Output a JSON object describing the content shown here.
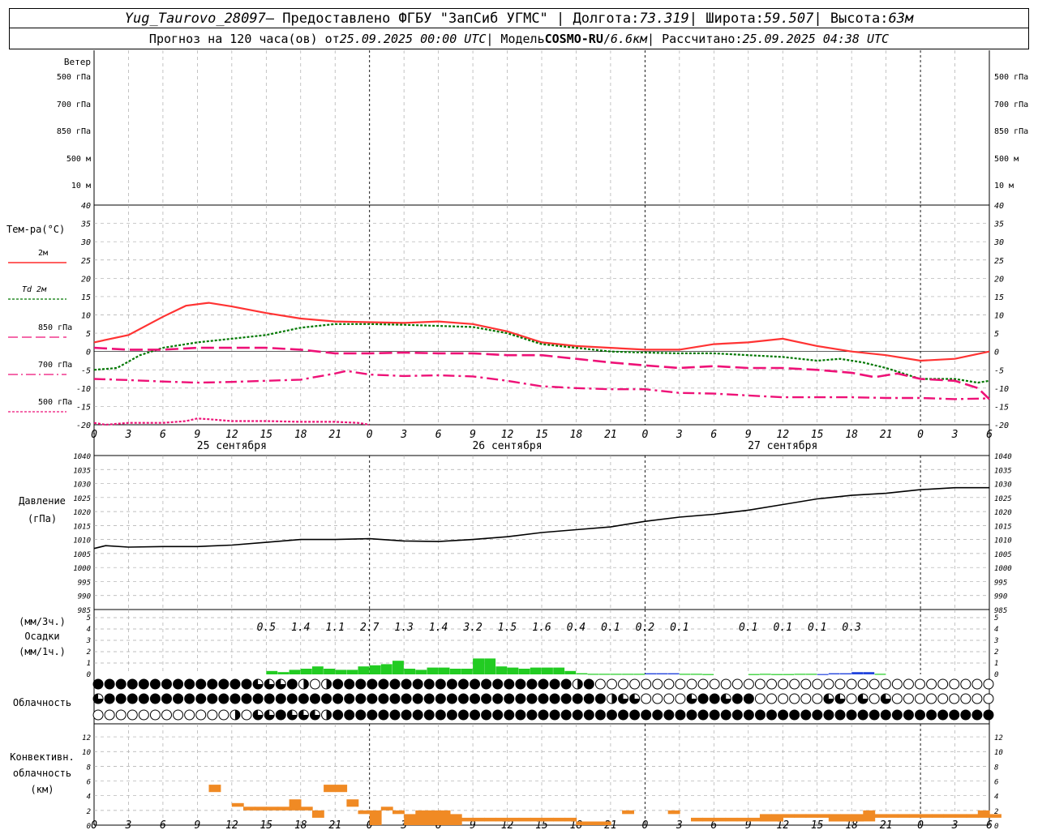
{
  "header": {
    "station": "Yug_Taurovo_28097",
    "provided": " – Предоставлено ФГБУ \"ЗапСиб УГМС\" | Долгота: ",
    "lon": "73.319",
    "lat_label": " | Широта: ",
    "lat": "59.507",
    "alt_label": " | Высота: ",
    "alt": "63м",
    "forecast_prefix": "Прогноз на 120 часа(ов) от ",
    "forecast_start": "25.09.2025 00:00 UTC",
    "model_label": "  | Модель ",
    "model": "COSMO-RU",
    "model_sep": " / ",
    "resolution": "6.6км",
    "calc_label": " | Рассчитано: ",
    "calc_time": "25.09.2025 04:38 UTC"
  },
  "wind_panel": {
    "title": "Ветер",
    "levels": [
      "500 гПа",
      "700 гПа",
      "850 гПа",
      "500 м",
      "10  м"
    ]
  },
  "temp_panel": {
    "title": "Тем-ра(°С)",
    "legend": [
      "2м",
      "Td  2м",
      "850 гПа",
      "700 гПа",
      "500 гПа"
    ],
    "legend_colors": [
      "#ff0000",
      "#007700",
      "#ee1177",
      "#ee1177",
      "#ee1177"
    ],
    "yticks": [
      "40",
      "35",
      "30",
      "25",
      "20",
      "15",
      "10",
      "5",
      "0",
      "-5",
      "-10",
      "-15",
      "-20"
    ]
  },
  "pressure_panel": {
    "title": "Давление",
    "unit": "(гПа)",
    "yticks": [
      "1040",
      "1035",
      "1030",
      "1025",
      "1020",
      "1015",
      "1010",
      "1005",
      "1000",
      "995",
      "990",
      "985"
    ]
  },
  "precip_panel": {
    "unit_3h": "(мм/3ч.)",
    "title": "Осадки",
    "unit_1h": "(мм/1ч.)",
    "yticks": [
      "5",
      "4",
      "3",
      "2",
      "1",
      "0"
    ],
    "totals": [
      {
        "hour": 15,
        "value": "0.5"
      },
      {
        "hour": 18,
        "value": "1.4"
      },
      {
        "hour": 21,
        "value": "1.1"
      },
      {
        "hour": 24,
        "value": "2.7"
      },
      {
        "hour": 27,
        "value": "1.3"
      },
      {
        "hour": 30,
        "value": "1.4"
      },
      {
        "hour": 33,
        "value": "3.2"
      },
      {
        "hour": 36,
        "value": "1.5"
      },
      {
        "hour": 39,
        "value": "1.6"
      },
      {
        "hour": 42,
        "value": "0.4"
      },
      {
        "hour": 45,
        "value": "0.1"
      },
      {
        "hour": 48,
        "value": "0.2"
      },
      {
        "hour": 51,
        "value": "0.1"
      },
      {
        "hour": 57,
        "value": "0.1"
      },
      {
        "hour": 60,
        "value": "0.1"
      },
      {
        "hour": 63,
        "value": "0.1"
      },
      {
        "hour": 66,
        "value": "0.3"
      }
    ]
  },
  "cloud_panel": {
    "title": "Облачность"
  },
  "conv_panel": {
    "title1": "Конвективн.",
    "title2": "облачность",
    "unit": "(км)",
    "yticks": [
      "12",
      "10",
      "8",
      "6",
      "4",
      "2",
      "0"
    ]
  },
  "x_axis": {
    "tick_labels": [
      "0",
      "3",
      "6",
      "9",
      "12",
      "15",
      "18",
      "21",
      "0",
      "3",
      "6",
      "9",
      "12",
      "15",
      "18",
      "21",
      "0",
      "3",
      "6",
      "9",
      "12",
      "15",
      "18",
      "21",
      "0",
      "3",
      "6"
    ],
    "day_labels": [
      "25 сентября",
      "26 сентября",
      "27 сентября"
    ]
  },
  "chart_data": {
    "type": "meteogram",
    "x_unit": "hours since 25.09.2025 00:00 UTC",
    "x_range": [
      0,
      78
    ],
    "temperature": {
      "ylim": [
        -20,
        40
      ],
      "series": [
        {
          "name": "2м",
          "color": "#ff3333",
          "style": "solid",
          "x": [
            0,
            3,
            6,
            8,
            10,
            12,
            15,
            18,
            21,
            24,
            27,
            30,
            33,
            36,
            39,
            42,
            45,
            48,
            51,
            54,
            57,
            60,
            63,
            66,
            69,
            72,
            75,
            78
          ],
          "y": [
            2.5,
            4.5,
            9.5,
            12.5,
            13.3,
            12.3,
            10.5,
            9,
            8.2,
            8,
            7.8,
            8.2,
            7.5,
            5.5,
            2.5,
            1.5,
            1,
            0.5,
            0.5,
            2,
            2.5,
            3.5,
            1.5,
            0,
            -1,
            -2.5,
            -2,
            0
          ]
        },
        {
          "name": "Td  2м",
          "color": "#007700",
          "style": "dotted",
          "x": [
            0,
            2,
            4,
            6,
            9,
            12,
            15,
            18,
            21,
            24,
            27,
            30,
            33,
            36,
            39,
            42,
            45,
            48,
            51,
            54,
            57,
            60,
            63,
            65,
            67,
            69,
            72,
            75,
            77,
            78
          ],
          "y": [
            -5,
            -4.5,
            -1,
            1,
            2.5,
            3.5,
            4.5,
            6.5,
            7.5,
            7.5,
            7.3,
            7,
            6.7,
            5,
            2,
            1,
            0,
            -0.3,
            -0.5,
            -0.5,
            -1,
            -1.5,
            -2.5,
            -2,
            -3,
            -4.5,
            -7.5,
            -7.5,
            -8.5,
            -8
          ]
        },
        {
          "name": "850 гПа",
          "color": "#ee1177",
          "style": "dash",
          "x": [
            0,
            3,
            6,
            9,
            12,
            15,
            18,
            21,
            24,
            27,
            30,
            33,
            36,
            39,
            42,
            45,
            48,
            51,
            54,
            57,
            60,
            63,
            66,
            68,
            69,
            70,
            72,
            75,
            77,
            78
          ],
          "y": [
            1,
            0.5,
            0.5,
            1,
            1,
            1,
            0.5,
            -0.5,
            -0.5,
            -0.3,
            -0.5,
            -0.5,
            -1,
            -1,
            -2,
            -3,
            -3.8,
            -4.5,
            -4,
            -4.5,
            -4.5,
            -5,
            -5.8,
            -7,
            -6.5,
            -6,
            -7.5,
            -8,
            -10,
            -13
          ]
        },
        {
          "name": "700 гПа",
          "color": "#ee1177",
          "style": "dashdot",
          "x": [
            0,
            3,
            6,
            9,
            12,
            15,
            18,
            21,
            22,
            24,
            27,
            30,
            33,
            36,
            39,
            42,
            45,
            48,
            51,
            54,
            57,
            60,
            63,
            66,
            69,
            72,
            75,
            78
          ],
          "y": [
            -7.5,
            -7.8,
            -8.2,
            -8.5,
            -8.3,
            -8,
            -7.7,
            -6,
            -5.3,
            -6.3,
            -6.7,
            -6.5,
            -6.8,
            -8,
            -9.5,
            -10,
            -10.3,
            -10.3,
            -11.3,
            -11.5,
            -12,
            -12.5,
            -12.5,
            -12.5,
            -12.7,
            -12.7,
            -13,
            -12.8
          ]
        },
        {
          "name": "500 гПа",
          "color": "#ee1177",
          "style": "dotted",
          "x": [
            0,
            1,
            3,
            6,
            8,
            9,
            10,
            12,
            15,
            18,
            21,
            23,
            24
          ],
          "y": [
            -19.5,
            -20,
            -19.5,
            -19.5,
            -19,
            -18.3,
            -18.5,
            -19,
            -19,
            -19.2,
            -19.2,
            -19.5,
            -20
          ]
        }
      ]
    },
    "pressure": {
      "ylim": [
        985,
        1040
      ],
      "x": [
        0,
        1,
        3,
        6,
        9,
        12,
        15,
        18,
        21,
        24,
        27,
        30,
        33,
        36,
        39,
        42,
        45,
        48,
        51,
        54,
        57,
        60,
        63,
        66,
        69,
        72,
        75,
        78
      ],
      "y": [
        1006.8,
        1007.8,
        1007.3,
        1007.5,
        1007.5,
        1008,
        1009,
        1010,
        1010,
        1010.3,
        1009.5,
        1009.3,
        1010,
        1011,
        1012.5,
        1013.5,
        1014.5,
        1016.5,
        1018,
        1019,
        1020.5,
        1022.5,
        1024.5,
        1025.8,
        1026.5,
        1027.8,
        1028.5,
        1028.5
      ]
    },
    "precip_hourly": {
      "ylim": [
        0,
        5
      ],
      "x": [
        15,
        16,
        17,
        18,
        19,
        20,
        21,
        22,
        23,
        24,
        25,
        26,
        27,
        28,
        29,
        30,
        31,
        32,
        33,
        34,
        35,
        36,
        37,
        38,
        39,
        40,
        41,
        42,
        43,
        44,
        45,
        46,
        47,
        48,
        49,
        50,
        51,
        52,
        53,
        54,
        55,
        56,
        57,
        58,
        59,
        60,
        61,
        62,
        63,
        64,
        65,
        66,
        67,
        68
      ],
      "y": [
        0.3,
        0.2,
        0.4,
        0.5,
        0.7,
        0.5,
        0.4,
        0.4,
        0.7,
        0.8,
        0.9,
        1.2,
        0.5,
        0.4,
        0.6,
        0.6,
        0.5,
        0.5,
        1.4,
        1.4,
        0.7,
        0.6,
        0.5,
        0.6,
        0.6,
        0.6,
        0.3,
        0.1,
        0.05,
        0.05,
        0.05,
        0.05,
        0.05,
        0.1,
        0.1,
        0.1,
        0.05,
        0.05,
        0.03,
        0,
        0,
        0,
        0.03,
        0.05,
        0.03,
        0.03,
        0.05,
        0.05,
        0.03,
        0.1,
        0.1,
        0.2,
        0.2,
        0.05
      ],
      "colors_note": "green = rain, blue = snow",
      "snow_x": [
        48,
        49,
        50,
        63,
        64,
        65,
        66,
        67
      ]
    },
    "cloudiness": {
      "rows": [
        "high",
        "middle",
        "low"
      ],
      "step_hours": 1,
      "high": "FFFFFFFFFFFFFFQQQFHEHFFFFFFFFFFFFFFFFFFFFFHFEEEEEEEEEEEEEEEEEEEEEEEEEEEEEEEEEEEEEEEE",
      "middle": "QFFFFFFFFFFFFFFFFFFFFFFFFFFFFFFFFFFFFFFFFFFFFHQQEEEEQFFQFFEEEEEEQQEQEQEEEEEEEEEEEEEEE",
      "low": "EEEEEEEEEEEEHEQQFQQQHFFFFFFFFFFFFFFFFFFFFFFFFFFFFFFFFFFFFFFFFFFFFFFFFFFFFFFFFFFFFFFF"
    },
    "convective_cloud": {
      "ylim": [
        0,
        13
      ],
      "unit": "km",
      "x": [
        10,
        11,
        12,
        13,
        14,
        15,
        16,
        17,
        18,
        19,
        20,
        21,
        22,
        23,
        24,
        25,
        26,
        27,
        28,
        29,
        30,
        31,
        32,
        33,
        34,
        35,
        36,
        37,
        38,
        39,
        40,
        41,
        42,
        43,
        44,
        45,
        46,
        47,
        48,
        49,
        50,
        51,
        52,
        53,
        54,
        55,
        56,
        57,
        58,
        59,
        60,
        61,
        62,
        63,
        64,
        65,
        66,
        67,
        68,
        69,
        70,
        71,
        72,
        73,
        74,
        75,
        76,
        77,
        78
      ],
      "bottom": [
        4.5,
        null,
        2.5,
        2,
        2,
        2,
        2,
        2,
        2,
        1,
        4.5,
        4.5,
        2.5,
        1.5,
        0,
        2,
        1.5,
        0,
        0,
        0,
        0,
        0,
        0.5,
        0.5,
        0.5,
        0.5,
        0.5,
        0.5,
        0.5,
        0.5,
        0.5,
        0.5,
        0,
        0,
        0,
        null,
        1.5,
        null,
        null,
        null,
        1.5,
        null,
        0.5,
        0.5,
        0.5,
        0.5,
        0.5,
        0.5,
        0.5,
        0.5,
        1,
        1,
        1,
        1,
        0.5,
        0.5,
        0.5,
        0.5,
        1,
        1,
        1,
        1,
        1,
        1,
        1,
        1,
        1,
        1,
        1
      ],
      "top": [
        5.5,
        null,
        3,
        2.5,
        2.5,
        2.5,
        2.5,
        3.5,
        2.5,
        2,
        5.5,
        5.5,
        3.5,
        2,
        2,
        2.5,
        2,
        1.5,
        2,
        2,
        2,
        1.5,
        1,
        1,
        1,
        1,
        1,
        1,
        1,
        1,
        1,
        1,
        0.5,
        0.5,
        0.5,
        null,
        2,
        null,
        null,
        null,
        2,
        null,
        1,
        1,
        1,
        1,
        1,
        1,
        1.5,
        1.5,
        1.5,
        1.5,
        1.5,
        1.5,
        1.5,
        1.5,
        1.5,
        2,
        1.5,
        1.5,
        1.5,
        1.5,
        1.5,
        1.5,
        1.5,
        1.5,
        1.5,
        2,
        1.5
      ]
    }
  }
}
